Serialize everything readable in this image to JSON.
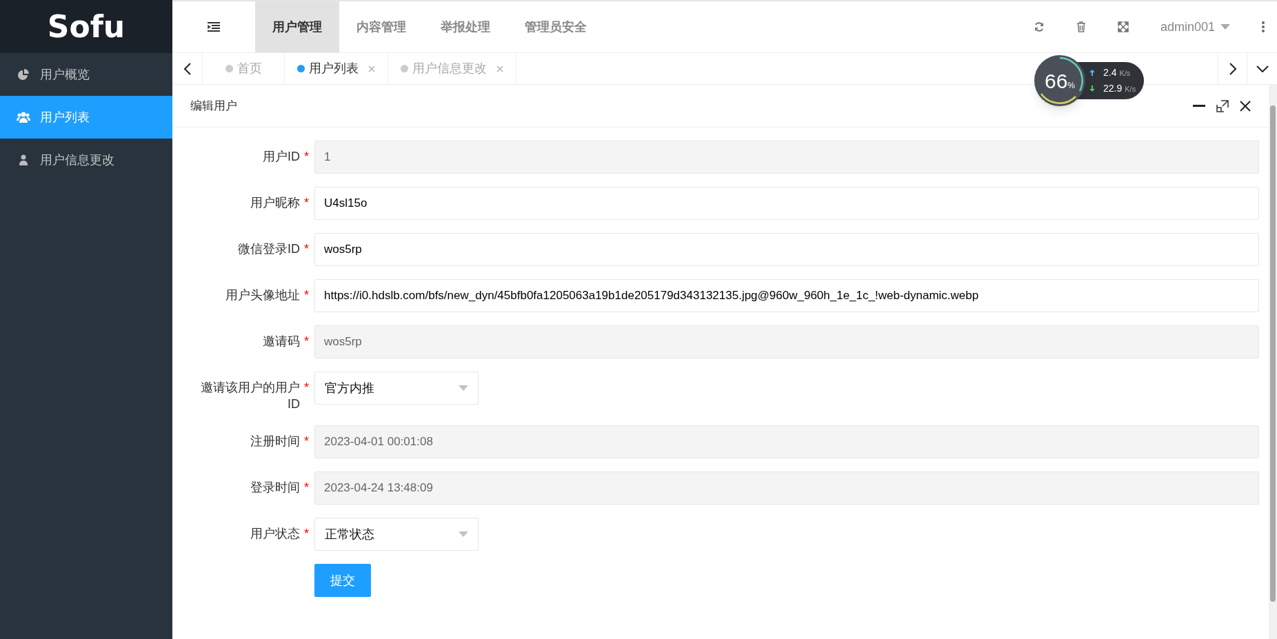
{
  "logo": "Sofu",
  "top_menu": [
    {
      "label": "用户管理",
      "selected": true
    },
    {
      "label": "内容管理",
      "selected": false
    },
    {
      "label": "举报处理",
      "selected": false
    },
    {
      "label": "管理员安全",
      "selected": false
    }
  ],
  "user": {
    "name": "admin001"
  },
  "sidebar": {
    "items": [
      {
        "label": "用户概览",
        "selected": false
      },
      {
        "label": "用户列表",
        "selected": true
      },
      {
        "label": "用户信息更改",
        "selected": false
      }
    ]
  },
  "page_tabs": [
    {
      "label": "首页",
      "closable": false,
      "selected": false
    },
    {
      "label": "用户列表",
      "closable": true,
      "selected": true
    },
    {
      "label": "用户信息更改",
      "closable": true,
      "selected": false
    }
  ],
  "net_widget": {
    "percent": "66",
    "percent_unit": "%",
    "upload": "2.4",
    "upload_unit": "K/s",
    "download": "22.9",
    "download_unit": "K/s"
  },
  "panel": {
    "title": "编辑用户",
    "fields": [
      {
        "label": "用户ID",
        "required_mark": "*",
        "kind": "input",
        "value": "1",
        "disabled": true
      },
      {
        "label": "用户昵称",
        "required_mark": "*",
        "kind": "input",
        "value": "U4sl15o",
        "disabled": false
      },
      {
        "label": "微信登录ID",
        "required_mark": "*",
        "kind": "input",
        "value": "wos5rp",
        "disabled": false
      },
      {
        "label": "用户头像地址",
        "required_mark": "*",
        "kind": "input",
        "value": "https://i0.hdslb.com/bfs/new_dyn/45bfb0fa1205063a19b1de205179d343132135.jpg@960w_960h_1e_1c_!web-dynamic.webp",
        "disabled": false
      },
      {
        "label": "邀请码",
        "required_mark": "*",
        "kind": "input",
        "value": "wos5rp",
        "disabled": true
      },
      {
        "label": "邀请该用户的用户ID",
        "required_mark": "*",
        "kind": "select",
        "value": "官方内推"
      },
      {
        "label": "注册时间",
        "required_mark": "*",
        "kind": "input",
        "value": "2023-04-01 00:01:08",
        "disabled": true
      },
      {
        "label": "登录时间",
        "required_mark": "*",
        "kind": "input",
        "value": "2023-04-24 13:48:09",
        "disabled": true
      },
      {
        "label": "用户状态",
        "required_mark": "*",
        "kind": "select",
        "value": "正常状态"
      }
    ],
    "submit": "提交"
  }
}
